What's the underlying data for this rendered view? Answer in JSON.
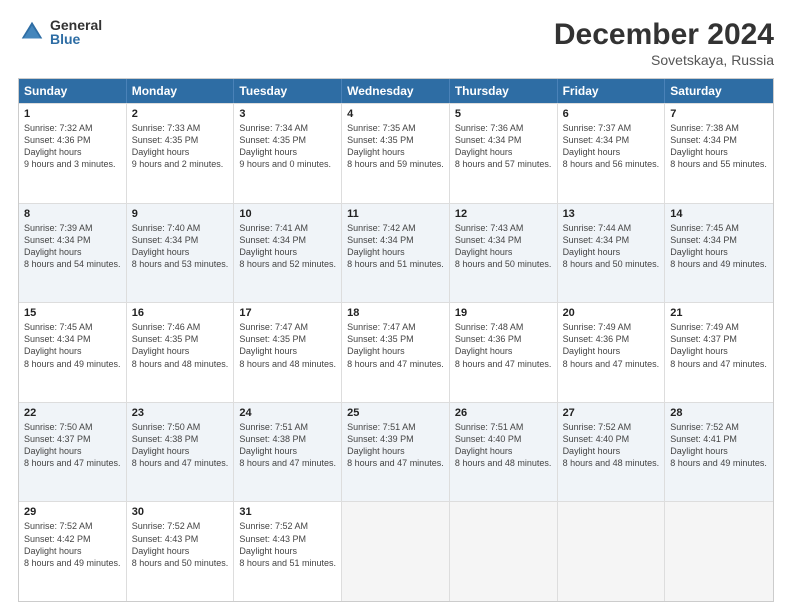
{
  "logo": {
    "general": "General",
    "blue": "Blue"
  },
  "header": {
    "title": "December 2024",
    "subtitle": "Sovetskaya, Russia"
  },
  "days_of_week": [
    "Sunday",
    "Monday",
    "Tuesday",
    "Wednesday",
    "Thursday",
    "Friday",
    "Saturday"
  ],
  "rows": [
    [
      {
        "day": "1",
        "sunrise": "7:32 AM",
        "sunset": "4:36 PM",
        "daylight": "9 hours and 3 minutes."
      },
      {
        "day": "2",
        "sunrise": "7:33 AM",
        "sunset": "4:35 PM",
        "daylight": "9 hours and 2 minutes."
      },
      {
        "day": "3",
        "sunrise": "7:34 AM",
        "sunset": "4:35 PM",
        "daylight": "9 hours and 0 minutes."
      },
      {
        "day": "4",
        "sunrise": "7:35 AM",
        "sunset": "4:35 PM",
        "daylight": "8 hours and 59 minutes."
      },
      {
        "day": "5",
        "sunrise": "7:36 AM",
        "sunset": "4:34 PM",
        "daylight": "8 hours and 57 minutes."
      },
      {
        "day": "6",
        "sunrise": "7:37 AM",
        "sunset": "4:34 PM",
        "daylight": "8 hours and 56 minutes."
      },
      {
        "day": "7",
        "sunrise": "7:38 AM",
        "sunset": "4:34 PM",
        "daylight": "8 hours and 55 minutes."
      }
    ],
    [
      {
        "day": "8",
        "sunrise": "7:39 AM",
        "sunset": "4:34 PM",
        "daylight": "8 hours and 54 minutes."
      },
      {
        "day": "9",
        "sunrise": "7:40 AM",
        "sunset": "4:34 PM",
        "daylight": "8 hours and 53 minutes."
      },
      {
        "day": "10",
        "sunrise": "7:41 AM",
        "sunset": "4:34 PM",
        "daylight": "8 hours and 52 minutes."
      },
      {
        "day": "11",
        "sunrise": "7:42 AM",
        "sunset": "4:34 PM",
        "daylight": "8 hours and 51 minutes."
      },
      {
        "day": "12",
        "sunrise": "7:43 AM",
        "sunset": "4:34 PM",
        "daylight": "8 hours and 50 minutes."
      },
      {
        "day": "13",
        "sunrise": "7:44 AM",
        "sunset": "4:34 PM",
        "daylight": "8 hours and 50 minutes."
      },
      {
        "day": "14",
        "sunrise": "7:45 AM",
        "sunset": "4:34 PM",
        "daylight": "8 hours and 49 minutes."
      }
    ],
    [
      {
        "day": "15",
        "sunrise": "7:45 AM",
        "sunset": "4:34 PM",
        "daylight": "8 hours and 49 minutes."
      },
      {
        "day": "16",
        "sunrise": "7:46 AM",
        "sunset": "4:35 PM",
        "daylight": "8 hours and 48 minutes."
      },
      {
        "day": "17",
        "sunrise": "7:47 AM",
        "sunset": "4:35 PM",
        "daylight": "8 hours and 48 minutes."
      },
      {
        "day": "18",
        "sunrise": "7:47 AM",
        "sunset": "4:35 PM",
        "daylight": "8 hours and 47 minutes."
      },
      {
        "day": "19",
        "sunrise": "7:48 AM",
        "sunset": "4:36 PM",
        "daylight": "8 hours and 47 minutes."
      },
      {
        "day": "20",
        "sunrise": "7:49 AM",
        "sunset": "4:36 PM",
        "daylight": "8 hours and 47 minutes."
      },
      {
        "day": "21",
        "sunrise": "7:49 AM",
        "sunset": "4:37 PM",
        "daylight": "8 hours and 47 minutes."
      }
    ],
    [
      {
        "day": "22",
        "sunrise": "7:50 AM",
        "sunset": "4:37 PM",
        "daylight": "8 hours and 47 minutes."
      },
      {
        "day": "23",
        "sunrise": "7:50 AM",
        "sunset": "4:38 PM",
        "daylight": "8 hours and 47 minutes."
      },
      {
        "day": "24",
        "sunrise": "7:51 AM",
        "sunset": "4:38 PM",
        "daylight": "8 hours and 47 minutes."
      },
      {
        "day": "25",
        "sunrise": "7:51 AM",
        "sunset": "4:39 PM",
        "daylight": "8 hours and 47 minutes."
      },
      {
        "day": "26",
        "sunrise": "7:51 AM",
        "sunset": "4:40 PM",
        "daylight": "8 hours and 48 minutes."
      },
      {
        "day": "27",
        "sunrise": "7:52 AM",
        "sunset": "4:40 PM",
        "daylight": "8 hours and 48 minutes."
      },
      {
        "day": "28",
        "sunrise": "7:52 AM",
        "sunset": "4:41 PM",
        "daylight": "8 hours and 49 minutes."
      }
    ],
    [
      {
        "day": "29",
        "sunrise": "7:52 AM",
        "sunset": "4:42 PM",
        "daylight": "8 hours and 49 minutes."
      },
      {
        "day": "30",
        "sunrise": "7:52 AM",
        "sunset": "4:43 PM",
        "daylight": "8 hours and 50 minutes."
      },
      {
        "day": "31",
        "sunrise": "7:52 AM",
        "sunset": "4:43 PM",
        "daylight": "8 hours and 51 minutes."
      },
      null,
      null,
      null,
      null
    ]
  ]
}
